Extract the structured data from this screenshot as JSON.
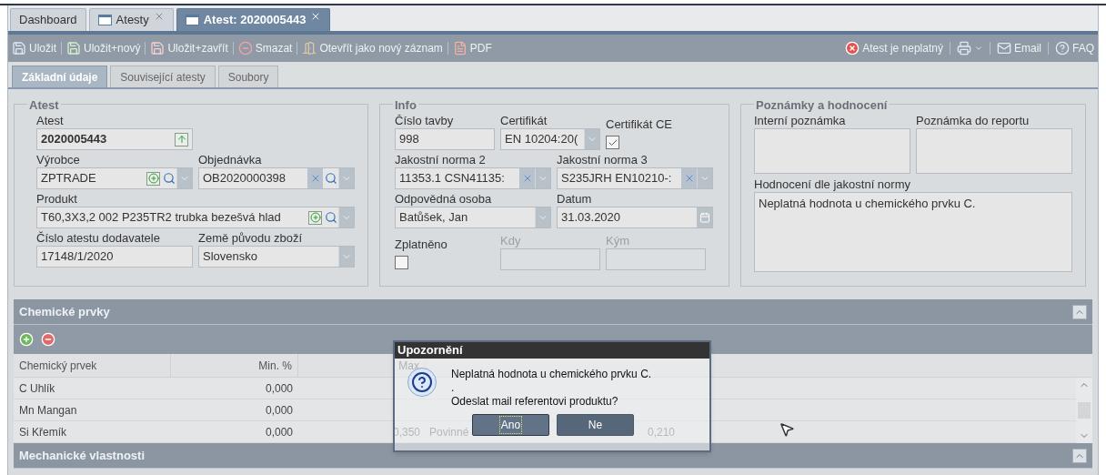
{
  "tabs": [
    {
      "label": "Dashboard",
      "selected": false,
      "closable": false,
      "icon": false
    },
    {
      "label": "Atesty",
      "selected": false,
      "closable": true,
      "icon": true
    },
    {
      "label": "Atest: 2020005443",
      "selected": true,
      "closable": true,
      "icon": true
    }
  ],
  "toolbar": {
    "left": [
      {
        "kind": "save",
        "label": "Uložit"
      },
      {
        "kind": "save-new",
        "label": "Uložit+nový"
      },
      {
        "kind": "save-close",
        "label": "Uložit+zavřít"
      },
      {
        "kind": "delete",
        "label": "Smazat"
      },
      {
        "kind": "open",
        "label": "Otevřít jako nový záznam"
      },
      {
        "kind": "pdf",
        "label": "PDF"
      }
    ],
    "right": [
      {
        "kind": "invalid",
        "label": "Atest je neplatný"
      },
      {
        "kind": "print"
      },
      {
        "kind": "email",
        "label": "Email"
      },
      {
        "kind": "help",
        "label": "FAQ"
      }
    ]
  },
  "subtabs": [
    {
      "label": "Základní údaje",
      "selected": true
    },
    {
      "label": "Související atesty",
      "selected": false
    },
    {
      "label": "Soubory",
      "selected": false
    }
  ],
  "sections": [
    {
      "title": "Atest",
      "fields": [
        {
          "kind": "text",
          "label": "Atest",
          "value": "2020005443",
          "actions": [
            {
              "kind": "up"
            }
          ],
          "disabled": false
        },
        {
          "kind": "combo",
          "label": "Výrobce",
          "value": "ZPTRADE",
          "actions": [
            {
              "kind": "add"
            },
            {
              "kind": "search"
            },
            {
              "kind": "dropdown"
            }
          ],
          "disabled": false
        },
        {
          "kind": "combo",
          "label": "Objednávka",
          "value": "OB2020000398",
          "actions": [
            {
              "kind": "clear"
            },
            {
              "kind": "search"
            },
            {
              "kind": "dropdown"
            }
          ],
          "disabled": false
        },
        {
          "kind": "combo",
          "label": "Produkt",
          "value": "T60,3X3,2 002 P235TR2 trubka bezešvá hlad",
          "actions": [
            {
              "kind": "add"
            },
            {
              "kind": "search"
            },
            {
              "kind": "dropdown"
            }
          ],
          "disabled": false
        },
        {
          "kind": "text",
          "label": "Číslo atestu dodavatele",
          "value": "17148/1/2020",
          "disabled": false
        },
        {
          "kind": "combo",
          "label": "Země původu zboží",
          "value": "Slovensko",
          "actions": [
            {
              "kind": "dropdown"
            }
          ],
          "disabled": false
        }
      ]
    },
    {
      "title": "Info",
      "fields": [
        {
          "kind": "text",
          "label": "Číslo tavby",
          "value": "998",
          "disabled": false
        },
        {
          "kind": "combo",
          "label": "Certifikát",
          "value": "EN 10204:20(",
          "actions": [
            {
              "kind": "dropdown"
            }
          ],
          "disabled": false
        },
        {
          "kind": "checkbox",
          "label": "Certifikát CE",
          "checked": true,
          "disabled": false
        },
        {
          "kind": "combo",
          "label": "Jakostní norma 2",
          "value": "11353.1 CSN41135:",
          "actions": [
            {
              "kind": "clear"
            },
            {
              "kind": "dropdown"
            }
          ],
          "disabled": false
        },
        {
          "kind": "combo",
          "label": "Jakostní norma 3",
          "value": "S235JRH EN10210-:",
          "actions": [
            {
              "kind": "clear"
            },
            {
              "kind": "dropdown"
            }
          ],
          "disabled": false
        },
        {
          "kind": "combo",
          "label": "Odpovědná osoba",
          "value": "Batůšek, Jan",
          "actions": [
            {
              "kind": "dropdown"
            }
          ],
          "disabled": false
        },
        {
          "kind": "date",
          "label": "Datum",
          "value": "31.03.2020",
          "actions": [
            {
              "kind": "calendar"
            }
          ],
          "disabled": false
        },
        {
          "kind": "checkbox",
          "label": "Zplatněno",
          "checked": false,
          "disabled": false
        },
        {
          "kind": "text",
          "label": "Kdy",
          "disabled": true
        },
        {
          "kind": "text",
          "label": "Kým",
          "disabled": true
        }
      ]
    },
    {
      "title": "Poznámky a hodnocení",
      "fields": [
        {
          "kind": "textarea",
          "label": "Interní poznámka",
          "disabled": false
        },
        {
          "kind": "textarea",
          "label": "Poznámka do reportu",
          "disabled": false
        },
        {
          "kind": "textarea",
          "label": "Hodnocení dle jakostní normy",
          "value": "Neplatná hodnota u chemického prvku C.",
          "disabled": false
        }
      ]
    }
  ],
  "chemical_panel": {
    "title": "Chemické prvky",
    "expanded": true,
    "columns": [
      "Chemický prvek",
      "Min. %",
      "Max"
    ],
    "rows": [
      {
        "element": "C Uhlík",
        "min": "0,000"
      },
      {
        "element": "Mn Mangan",
        "min": "0,000"
      },
      {
        "element": "Si Křemík",
        "min": "0,000",
        "max": "0,350",
        "column_4": "Povinné",
        "column_5": "0,210"
      }
    ]
  },
  "mechanical_panel": {
    "title": "Mechanické vlastnosti",
    "expanded": true
  },
  "dialog": {
    "title": "Upozornění",
    "lines": [
      "Neplatná hodnota u chemického prvku C.",
      ".",
      "Odeslat mail referentovi produktu?"
    ],
    "buttons": [
      {
        "label": "Ano",
        "focused": true
      },
      {
        "label": "Ne",
        "focused": false
      }
    ]
  }
}
